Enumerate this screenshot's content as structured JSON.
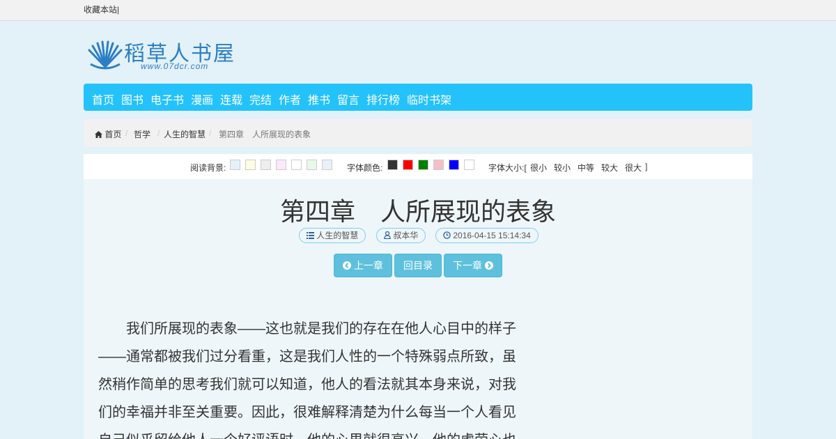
{
  "topbar": {
    "bookmark": "收藏本站|"
  },
  "logo": {
    "name": "稻草人书屋",
    "url": "www.07dcr.com"
  },
  "nav": {
    "items": [
      "首页",
      "图书",
      "电子书",
      "漫画",
      "连载",
      "完结",
      "作者",
      "推书",
      "留言",
      "排行榜",
      "临时书架"
    ]
  },
  "breadcrumb": {
    "home": "首页",
    "category": "哲学",
    "book": "人生的智慧",
    "current": "第四章　人所展现的表象"
  },
  "toolbar": {
    "bg_label": "阅读背景:",
    "bg_colors": [
      "#e5f0fb",
      "#fdfde2",
      "#eeeeee",
      "#fbe9fb",
      "#ffffff",
      "#e9f9e9",
      "#e9f1f9"
    ],
    "font_color_label": "字体颜色:",
    "font_colors": [
      "#333333",
      "#ff0000",
      "#008000",
      "#f4c0c8",
      "#0000ff",
      "#ffffff"
    ],
    "size_label": "字体大小:[",
    "sizes": [
      "很小",
      "较小",
      "中等",
      "较大",
      "很大"
    ],
    "size_close": "]"
  },
  "chapter": {
    "title": "第四章　人所展现的表象",
    "book": "人生的智慧",
    "author": "叔本华",
    "datetime": "2016-04-15 15:14:34",
    "prev": "上一章",
    "toc": "回目录",
    "next": "下一章",
    "text": "　　我们所展现的表象——这也就是我们的存在在他人心目中的样子——通常都被我们过分看重，这是我们人性的一个特殊弱点所致，虽然稍作简单的思考我们就可以知道，他人的看法就其本身来说，对我们的幸福并非至关重要。因此，很难解释清楚为什么每当一个人看见自己似乎留给他人一个好评语时，他的心里就很高兴，他的虚荣心也"
  },
  "colors": {
    "nav_bg": "#24c2fa",
    "button_bg": "#5ec0dc",
    "content_bg": "#eef6fa"
  }
}
